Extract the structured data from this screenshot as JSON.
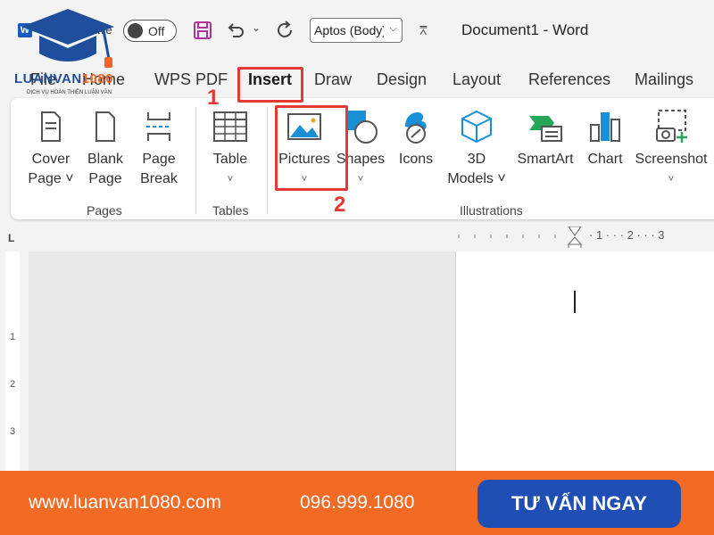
{
  "titlebar": {
    "app_icon_letter": "W",
    "autosave_label": "Save",
    "autosave_state": "Off",
    "font_name": "Aptos (Body)",
    "document_title": "Document1  -  Word",
    "more_glyph": "⩞"
  },
  "logo": {
    "brand_text": "LUANVAN",
    "brand_number": "1080",
    "tagline": "DỊCH VỤ HOÀN THIỆN LUẬN VĂN"
  },
  "tabs": {
    "file": "File",
    "home": "Home",
    "wps_pdf": "WPS PDF",
    "insert": "Insert",
    "draw": "Draw",
    "design": "Design",
    "layout": "Layout",
    "references": "References",
    "mailings": "Mailings"
  },
  "annotations": {
    "step1": "1",
    "step2": "2",
    "highlight_color": "#e53935"
  },
  "ribbon": {
    "cover_page": [
      "Cover",
      "Page ˅"
    ],
    "blank_page": [
      "Blank",
      "Page"
    ],
    "page_break": [
      "Page",
      "Break"
    ],
    "table": [
      "Table",
      "˅"
    ],
    "pictures": [
      "Pictures",
      "˅"
    ],
    "shapes": [
      "Shapes",
      "˅"
    ],
    "icons": [
      "Icons"
    ],
    "models_3d": [
      "3D",
      "Models ˅"
    ],
    "smartart": [
      "SmartArt"
    ],
    "chart": [
      "Chart"
    ],
    "screenshot": [
      "Screenshot",
      "˅"
    ],
    "groups": {
      "pages": "Pages",
      "tables": "Tables",
      "illustrations": "Illustrations"
    }
  },
  "rulers": {
    "corner": "L",
    "horizontal": [
      "·  1  ·  ·  ·  2  ·  ·  ·  3"
    ],
    "vertical": [
      "1",
      "2",
      "3"
    ]
  },
  "banner": {
    "website": "www.luanvan1080.com",
    "phone": "096.999.1080",
    "cta_label": "TƯ VẤN NGAY",
    "bg_color": "#f26a24",
    "cta_color": "#1f4fb4"
  },
  "colors": {
    "word_blue": "#185abd",
    "save_purple": "#b0329c"
  }
}
